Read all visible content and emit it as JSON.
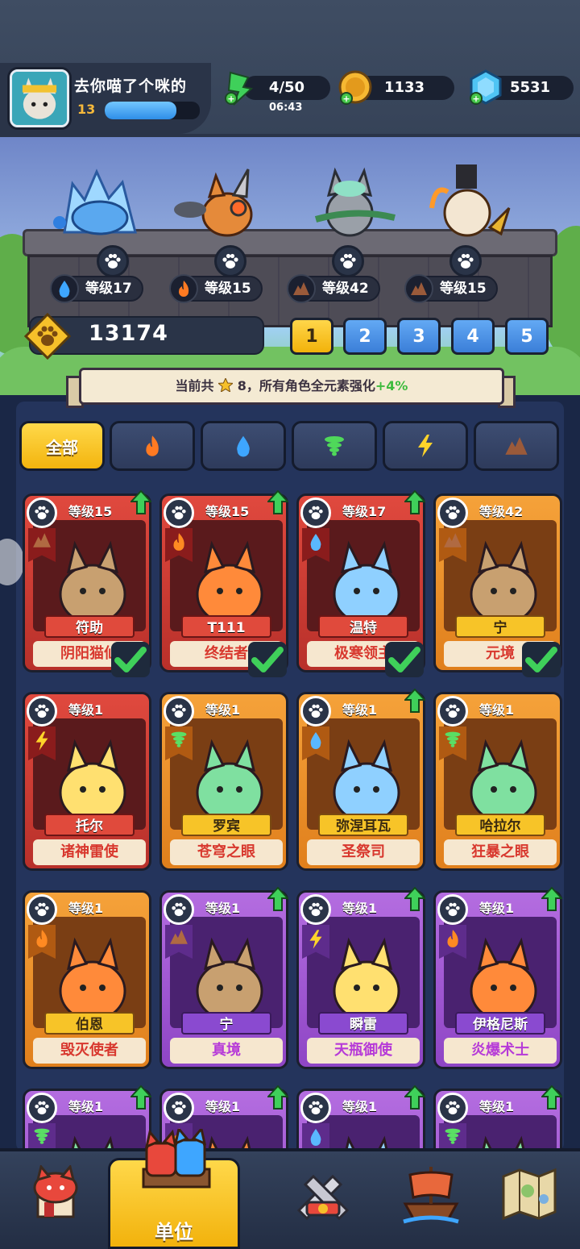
{
  "player": {
    "name": "去你喵了个咪的",
    "level": "13",
    "xp_fraction": 0.75
  },
  "resources": {
    "energy": "4/50",
    "energy_timer": "06:43",
    "coins": "1133",
    "gems": "5531"
  },
  "team": {
    "heroes": [
      {
        "level_label": "等级17",
        "element": "water"
      },
      {
        "level_label": "等级15",
        "element": "fire"
      },
      {
        "level_label": "等级42",
        "element": "earth"
      },
      {
        "level_label": "等级15",
        "element": "earth"
      }
    ],
    "power": "13174",
    "slots": [
      "1",
      "2",
      "3",
      "4",
      "5"
    ],
    "active_slot": "1"
  },
  "banner": {
    "prefix": "当前共",
    "stars": "8",
    "middle": "，所有角色全元素强化",
    "bonus": "+4%"
  },
  "filters": {
    "all_label": "全部",
    "icons": [
      "fire",
      "water",
      "wind",
      "lightning",
      "earth"
    ]
  },
  "cards": [
    {
      "level": "等级15",
      "name": "符助",
      "title": "阴阳猫仙",
      "rarity": "red",
      "element": "earth",
      "upgrade": true,
      "equipped": true
    },
    {
      "level": "等级15",
      "name": "T111",
      "title": "终结者",
      "rarity": "red",
      "element": "fire",
      "upgrade": true,
      "equipped": true
    },
    {
      "level": "等级17",
      "name": "温特",
      "title": "极寒领主",
      "rarity": "red",
      "element": "water",
      "upgrade": true,
      "equipped": true
    },
    {
      "level": "等级42",
      "name": "宁",
      "title": "元境",
      "rarity": "orange",
      "element": "earth",
      "upgrade": false,
      "equipped": true
    },
    {
      "level": "等级1",
      "name": "托尔",
      "title": "诸神雷使",
      "rarity": "red",
      "element": "lightning",
      "upgrade": false,
      "equipped": false
    },
    {
      "level": "等级1",
      "name": "罗宾",
      "title": "苍穹之眼",
      "rarity": "orange",
      "element": "wind",
      "upgrade": false,
      "equipped": false
    },
    {
      "level": "等级1",
      "name": "弥涅耳瓦",
      "title": "圣祭司",
      "rarity": "orange",
      "element": "water",
      "upgrade": true,
      "equipped": false
    },
    {
      "level": "等级1",
      "name": "哈拉尔",
      "title": "狂暴之眼",
      "rarity": "orange",
      "element": "wind",
      "upgrade": false,
      "equipped": false
    },
    {
      "level": "等级1",
      "name": "伯恩",
      "title": "毁灭使者",
      "rarity": "orange",
      "element": "fire",
      "upgrade": false,
      "equipped": false
    },
    {
      "level": "等级1",
      "name": "宁",
      "title": "真境",
      "rarity": "purple",
      "element": "earth",
      "upgrade": true,
      "equipped": false
    },
    {
      "level": "等级1",
      "name": "瞬雷",
      "title": "天瓶御使",
      "rarity": "purple",
      "element": "lightning",
      "upgrade": true,
      "equipped": false
    },
    {
      "level": "等级1",
      "name": "伊格尼斯",
      "title": "炎爆术士",
      "rarity": "purple",
      "element": "fire",
      "upgrade": true,
      "equipped": false
    },
    {
      "level": "等级1",
      "rarity": "purple",
      "element": "wind",
      "upgrade": true
    },
    {
      "level": "等级1",
      "rarity": "purple",
      "element": "fire",
      "upgrade": true
    },
    {
      "level": "等级1",
      "rarity": "purple",
      "element": "water",
      "upgrade": true
    },
    {
      "level": "等级1",
      "rarity": "purple",
      "element": "wind",
      "upgrade": true
    }
  ],
  "nav": {
    "active_label": "单位",
    "items": [
      "home",
      "units",
      "battle",
      "voyage",
      "map"
    ]
  },
  "colors": {
    "gold": "#f6c02a",
    "panel": "#24345c",
    "red_card": "#d03a30",
    "orange_card": "#ee9428",
    "purple_card": "#a25ad8"
  }
}
